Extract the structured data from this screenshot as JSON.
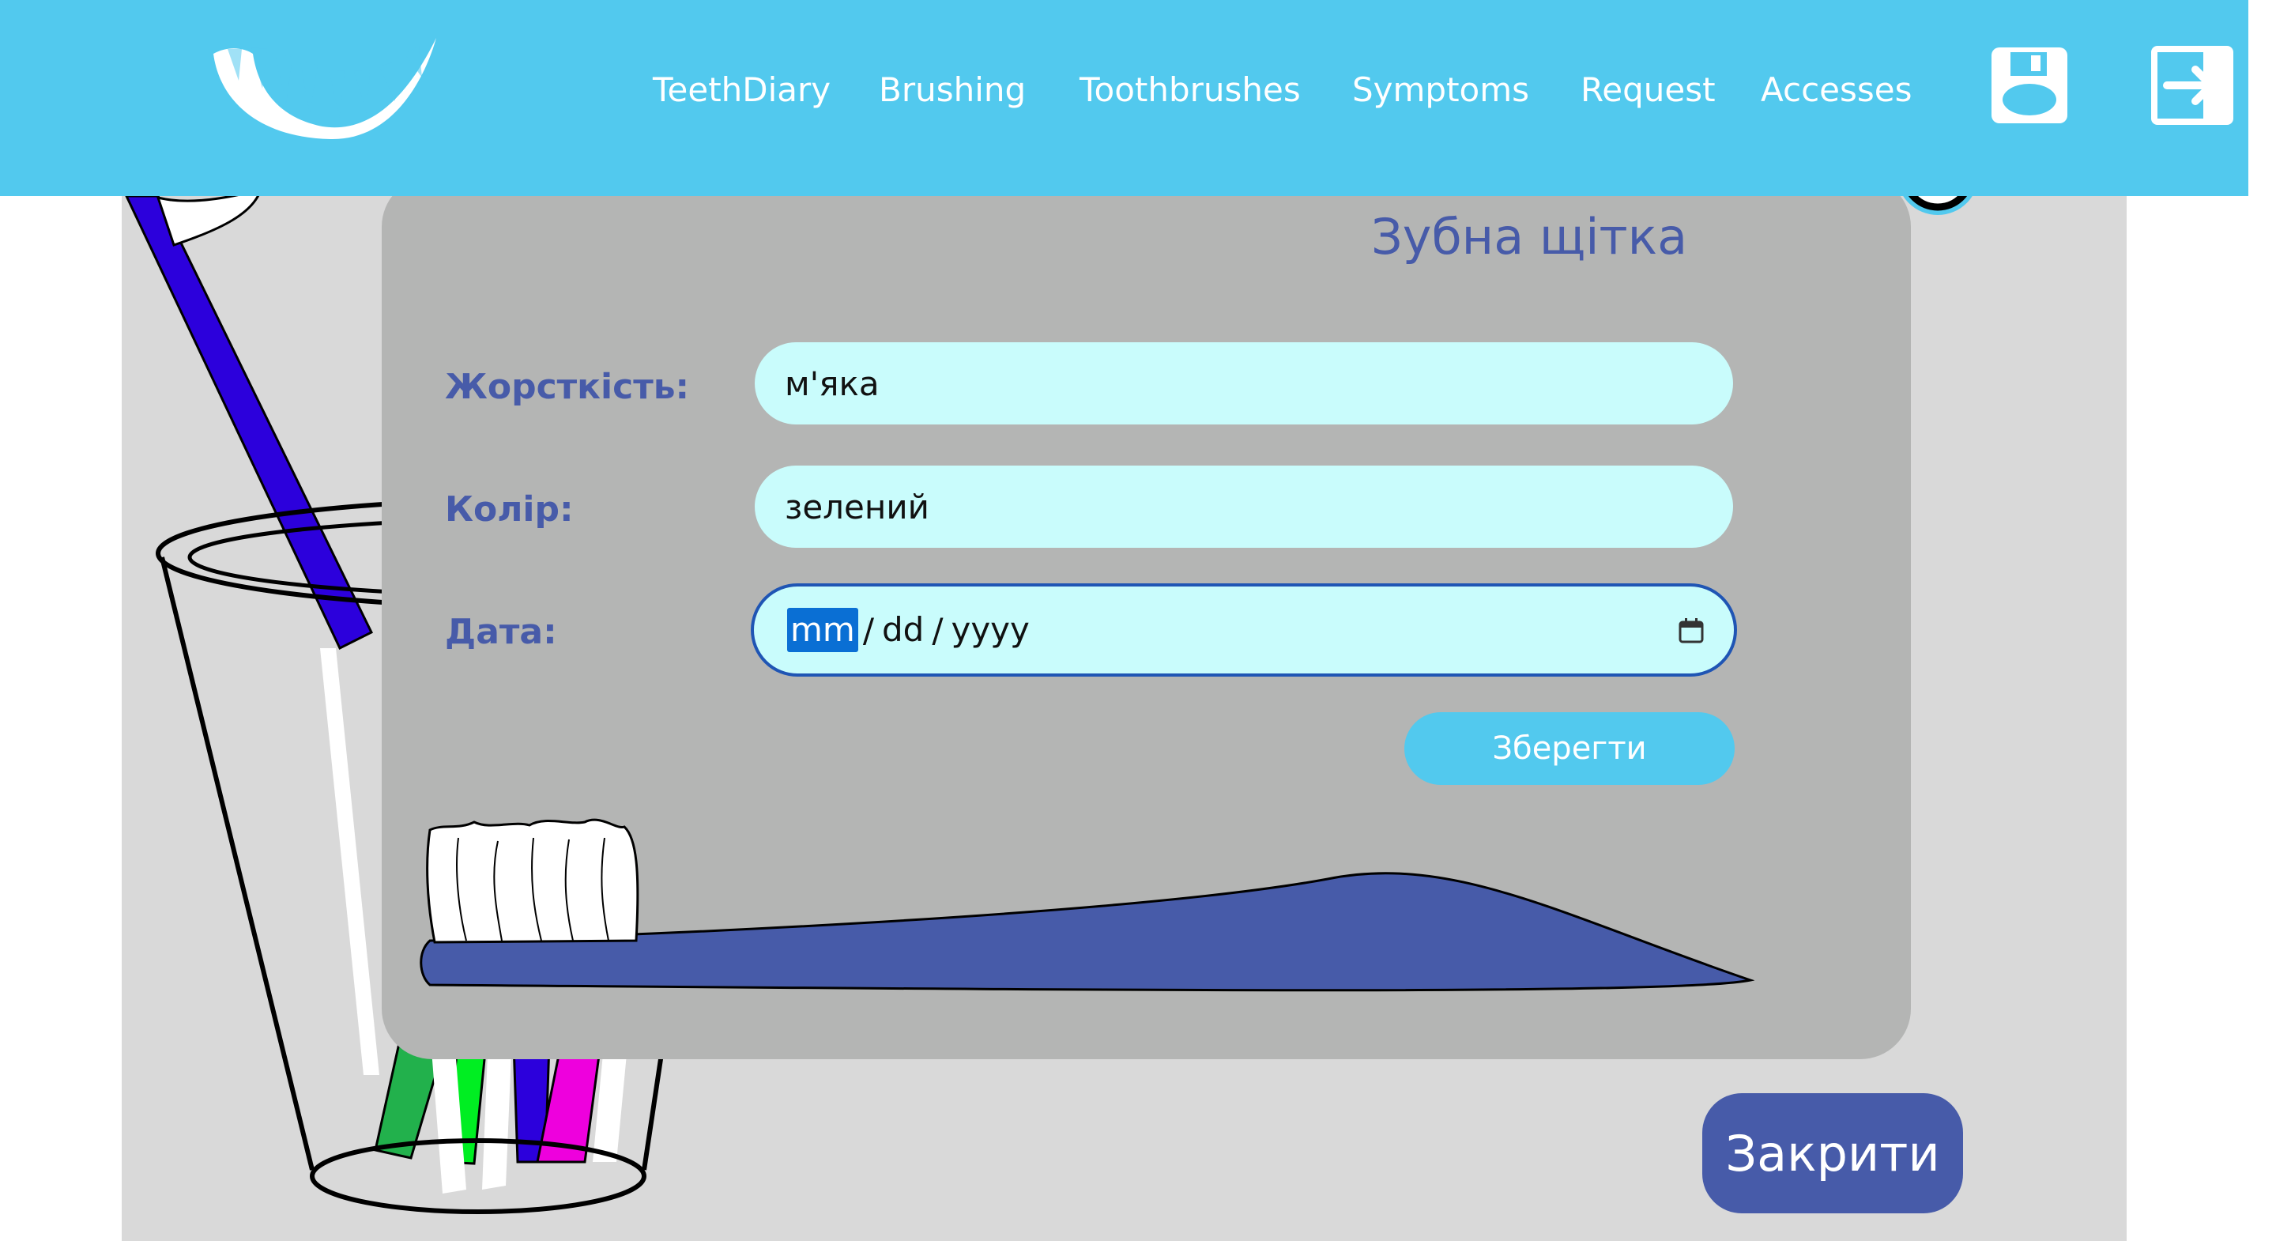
{
  "nav": {
    "items": [
      "TeethDiary",
      "Brushing",
      "Toothbrushes",
      "Symptoms",
      "Request",
      "Accesses"
    ]
  },
  "icons": {
    "logo": "teeth-wing-logo",
    "save_disk": "floppy-disk-icon",
    "logout": "logout-icon",
    "calendar": "calendar-icon"
  },
  "form": {
    "title": "Зубна щітка",
    "hardness": {
      "label": "Жорсткість:",
      "value": "м'яка"
    },
    "color": {
      "label": "Колір:",
      "value": "зелений"
    },
    "date": {
      "label": "Дата:",
      "month": "mm",
      "day": "dd",
      "year": "yyyy",
      "sep": "/"
    },
    "save_label": "Зберегти"
  },
  "close_label": "Закрити",
  "colors": {
    "topbar": "#52c9ee",
    "accent": "#475ba9",
    "card": "#b4b5b4",
    "input": "#c9fcfc",
    "page_bg": "#d9d9d9"
  }
}
